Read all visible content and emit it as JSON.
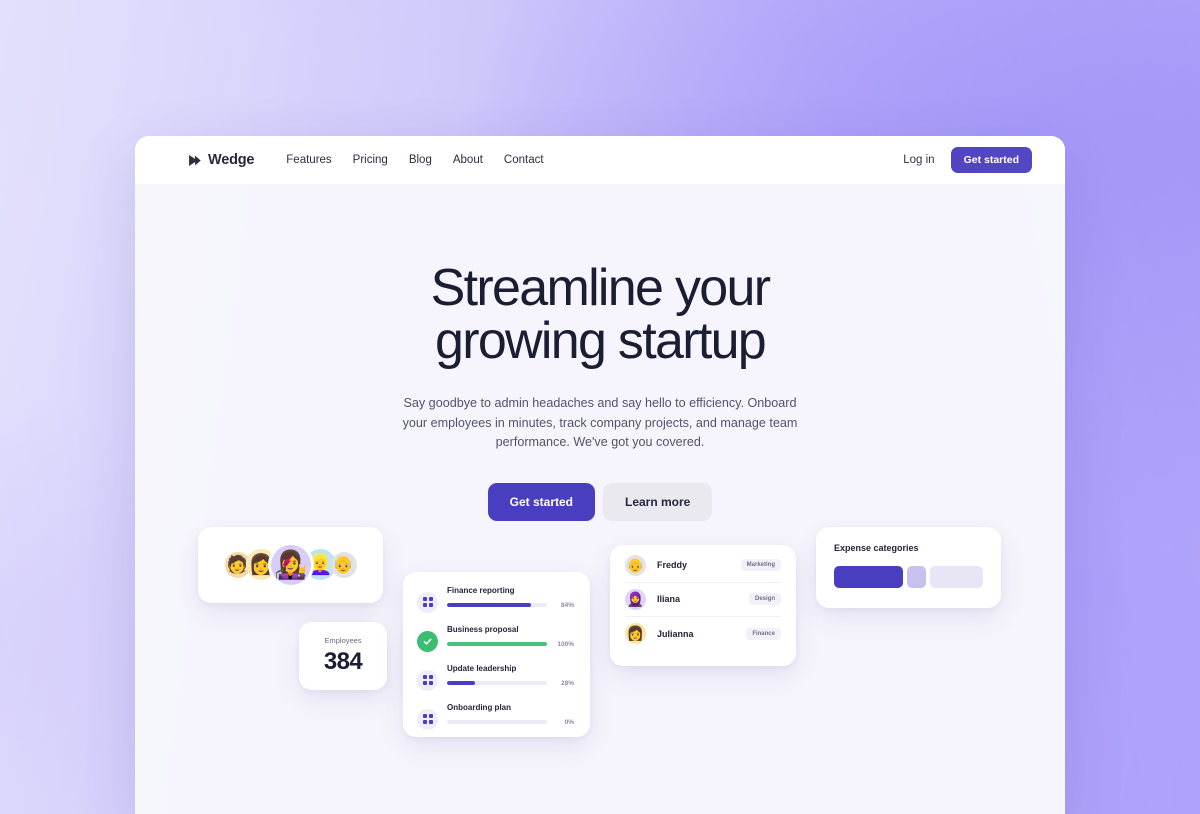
{
  "nav": {
    "brand": "Wedge",
    "brand_icon": "wedge-arrow-logo",
    "links": [
      {
        "label": "Features"
      },
      {
        "label": "Pricing"
      },
      {
        "label": "Blog"
      },
      {
        "label": "About"
      },
      {
        "label": "Contact"
      }
    ],
    "login_label": "Log in",
    "get_started_label": "Get started"
  },
  "hero": {
    "title_line1": "Streamline your",
    "title_line2": "growing startup",
    "subtitle": "Say goodbye to admin headaches and say hello to efficiency. Onboard your employees in minutes, track company projects, and manage team performance. We've got you covered.",
    "cta_primary": "Get started",
    "cta_secondary": "Learn more"
  },
  "cards": {
    "avatars": {
      "people": [
        {
          "emoji": "🧑",
          "bg": "#f6d7a8"
        },
        {
          "emoji": "👩",
          "bg": "#f8e9b5"
        },
        {
          "emoji": "👩‍🎤",
          "bg": "#d7cdf7"
        },
        {
          "emoji": "👱‍♀️",
          "bg": "#bfe3f5"
        },
        {
          "emoji": "👴",
          "bg": "#e3e1e4"
        }
      ]
    },
    "employees": {
      "label": "Employees",
      "value": "384"
    },
    "tasks": {
      "items": [
        {
          "name": "Finance reporting",
          "percent": "84%",
          "fill": 84,
          "color": "#4a3ec0",
          "icon": "grid-icon",
          "done": false
        },
        {
          "name": "Business proposal",
          "percent": "100%",
          "fill": 100,
          "color": "#4cc17d",
          "icon": "check-icon",
          "done": true
        },
        {
          "name": "Update leadership",
          "percent": "28%",
          "fill": 28,
          "color": "#4a3ec0",
          "icon": "grid-icon",
          "done": false
        },
        {
          "name": "Onboarding plan",
          "percent": "0%",
          "fill": 0,
          "color": "#4a3ec0",
          "icon": "grid-icon",
          "done": false
        }
      ]
    },
    "people": {
      "rows": [
        {
          "name": "Freddy",
          "tag": "Marketing",
          "emoji": "👴",
          "bg": "#e4e2e5"
        },
        {
          "name": "Iliana",
          "tag": "Design",
          "emoji": "🧕",
          "bg": "#ded4f7"
        },
        {
          "name": "Julianna",
          "tag": "Finance",
          "emoji": "👩",
          "bg": "#fbe6a6"
        }
      ]
    },
    "expense": {
      "title": "Expense categories",
      "segments": [
        {
          "width": 78,
          "color": "#4a3ec0"
        },
        {
          "width": 22,
          "color": "#c7c1ee"
        },
        {
          "width": 60,
          "color": "#e8e6f6"
        }
      ]
    }
  }
}
